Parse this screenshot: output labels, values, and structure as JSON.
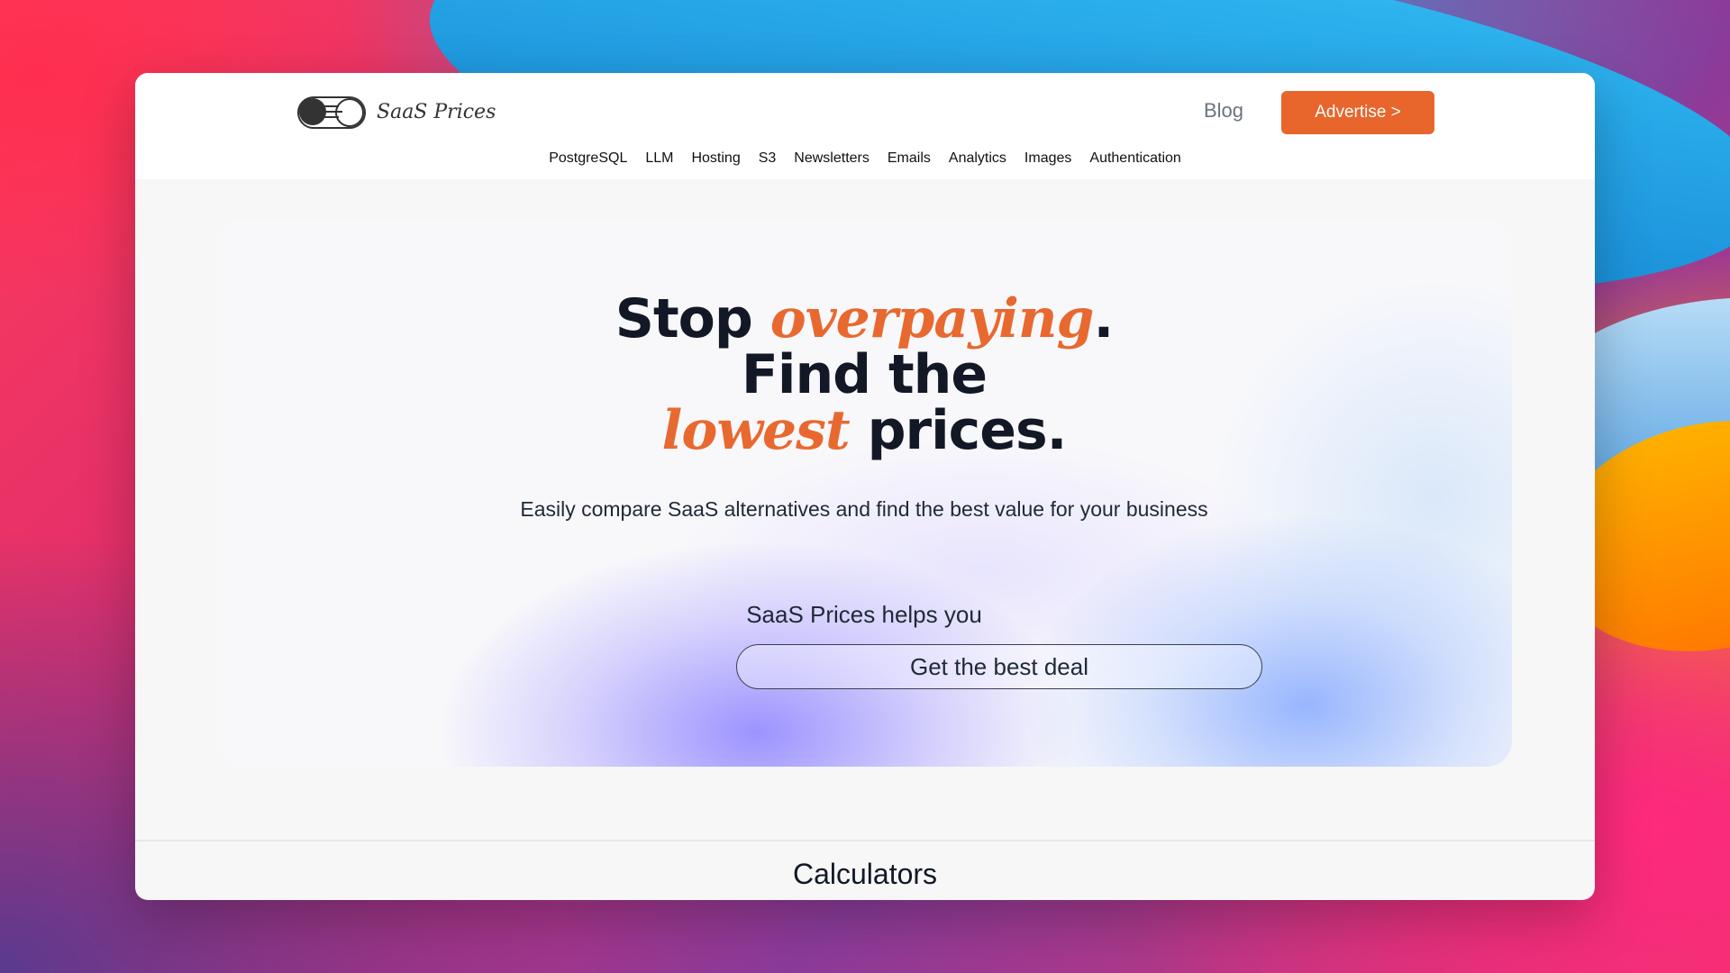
{
  "header": {
    "logo_text": "SaaS Prices",
    "blog_label": "Blog",
    "advertise_label": "Advertise >"
  },
  "nav": {
    "items": [
      "PostgreSQL",
      "LLM",
      "Hosting",
      "S3",
      "Newsletters",
      "Emails",
      "Analytics",
      "Images",
      "Authentication"
    ]
  },
  "hero": {
    "line1_start": "Stop",
    "line1_accent": "overpaying",
    "line1_end": ".",
    "line2": "Find the",
    "line3_accent": "lowest",
    "line3_end": "prices.",
    "subtitle": "Easily compare SaaS alternatives and find the best value for your business",
    "helps_label": "SaaS Prices helps you",
    "cta_label": "Get the best deal"
  },
  "section": {
    "title": "Calculators"
  },
  "colors": {
    "accent": "#e8652c",
    "text": "#121826"
  }
}
